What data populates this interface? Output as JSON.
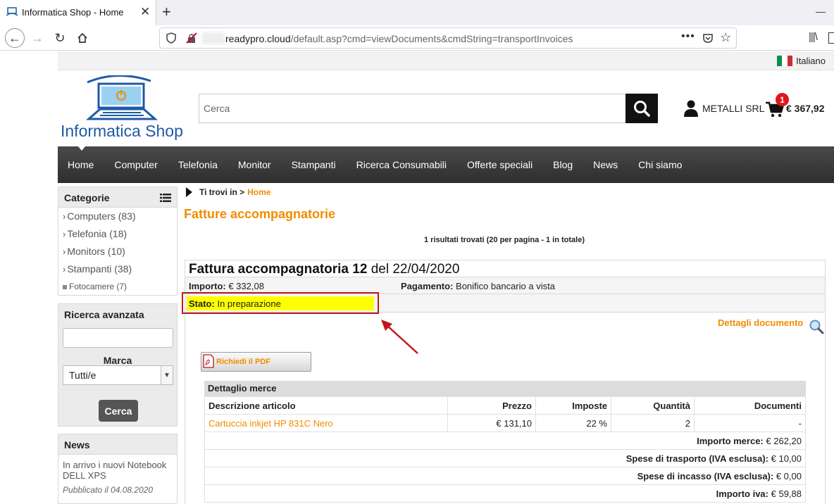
{
  "browser": {
    "tab_title": "Informatica Shop - Home",
    "url_host": "readypro.cloud",
    "url_path": "/default.asp?cmd=viewDocuments&cmdString=transportInvoices"
  },
  "topbar": {
    "language": "Italiano"
  },
  "header": {
    "logo_text": "Informatica Shop",
    "search_placeholder": "Cerca",
    "user_name": "METALLI SRL",
    "cart_count": "1",
    "cart_total": "€ 367,92"
  },
  "nav": {
    "items": [
      "Home",
      "Computer",
      "Telefonia",
      "Monitor",
      "Stampanti",
      "Ricerca Consumabili",
      "Offerte speciali",
      "Blog",
      "News",
      "Chi siamo"
    ]
  },
  "sidebar": {
    "categories_title": "Categorie",
    "categories": [
      "Computers (83)",
      "Telefonia (18)",
      "Monitors (10)",
      "Stampanti (38)",
      "Fotocamere (7)"
    ],
    "advanced_title": "Ricerca avanzata",
    "brand_label": "Marca",
    "brand_selected": "Tutti/e",
    "search_button": "Cerca",
    "news_title": "News",
    "news_text": "In arrivo i nuovi Notebook DELL XPS",
    "news_date": "Pubblicato il 04.08.2020"
  },
  "main": {
    "breadcrumb_prefix": "Ti trovi in >",
    "breadcrumb_home": "Home",
    "title": "Fatture accompagnatorie",
    "results": "1 risultati trovati (20 per pagina - 1 in totale)",
    "doc": {
      "name": "Fattura accompagnatoria 12",
      "date": "del 22/04/2020",
      "importo_label": "Importo:",
      "importo_value": "€ 332,08",
      "pagamento_label": "Pagamento:",
      "pagamento_value": "Bonifico bancario a vista",
      "stato_label": "Stato:",
      "stato_value": "In preparazione",
      "details_link": "Dettagli documento",
      "pdf_button": "Richiedi il PDF",
      "items_title": "Dettaglio merce",
      "columns": [
        "Descrizione articolo",
        "Prezzo",
        "Imposte",
        "Quantità",
        "Documenti"
      ],
      "rows": [
        {
          "descrizione": "Cartuccia inkjet HP 831C Nero",
          "prezzo": "€ 131,10",
          "imposte": "22 %",
          "quantita": "2",
          "documenti": "-"
        }
      ],
      "totals": [
        {
          "label": "Importo merce:",
          "value": "€ 262,20"
        },
        {
          "label": "Spese di trasporto (IVA esclusa):",
          "value": "€ 10,00"
        },
        {
          "label": "Spese di incasso (IVA esclusa):",
          "value": "€ 0,00"
        },
        {
          "label": "Importo iva:",
          "value": "€ 59,88"
        }
      ]
    }
  },
  "colors": {
    "accent": "#f08c00",
    "nav_bg": "#3a3a3a",
    "highlight": "#ffff00",
    "annotation": "#c0161c"
  }
}
